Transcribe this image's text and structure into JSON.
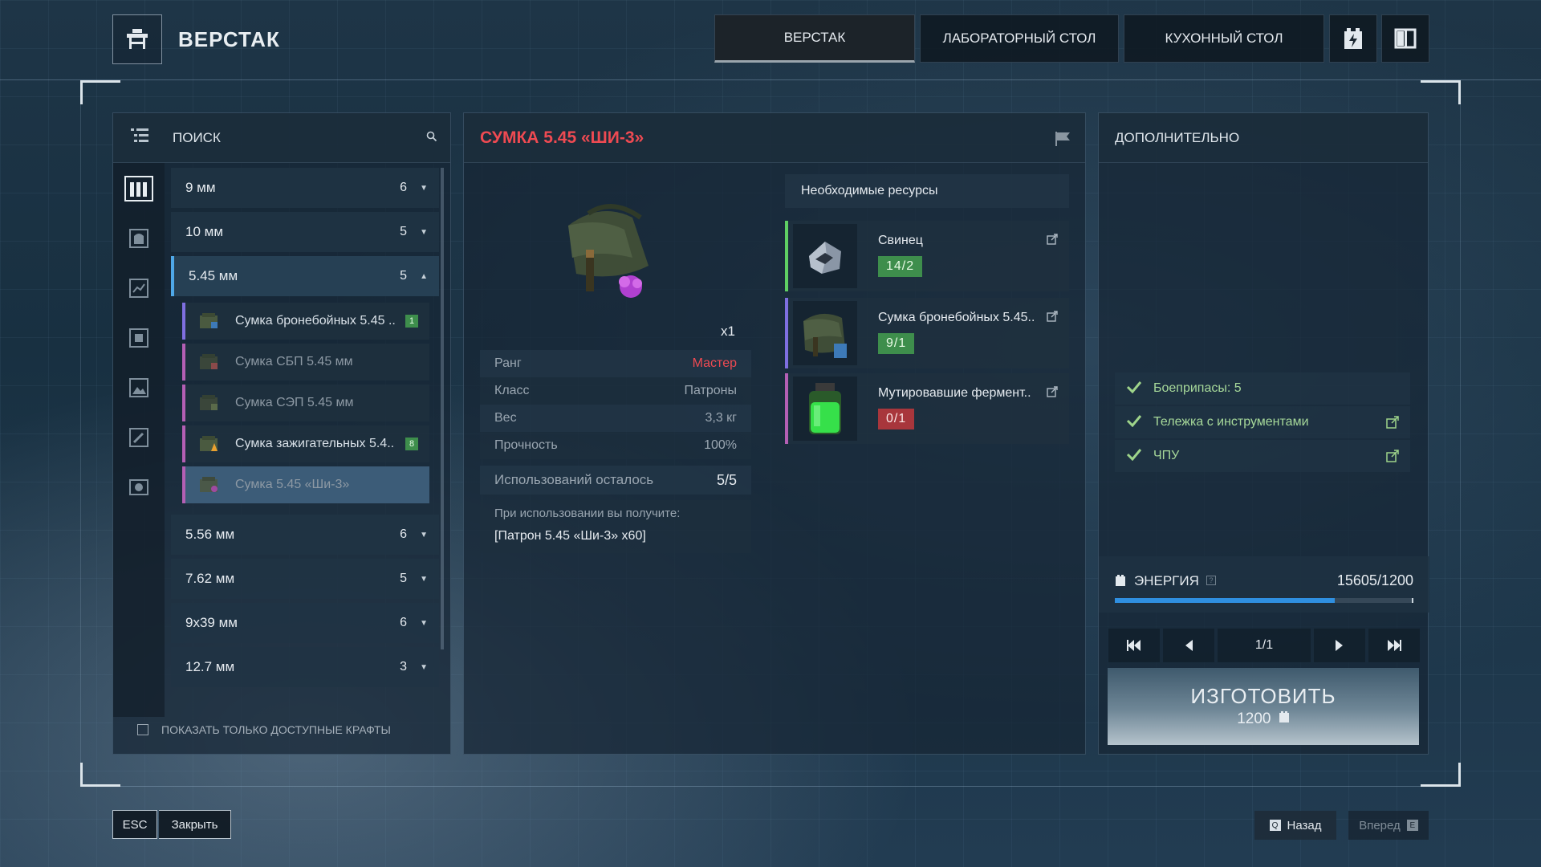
{
  "header": {
    "title": "ВЕРСТАК",
    "tabs": [
      {
        "label": "ВЕРСТАК",
        "active": true
      },
      {
        "label": "ЛАБОРАТОРНЫЙ СТОЛ",
        "active": false
      },
      {
        "label": "КУХОННЫЙ СТОЛ",
        "active": false
      }
    ],
    "icons": [
      "battery-icon",
      "book-icon"
    ]
  },
  "left_panel": {
    "search_label": "ПОИСК",
    "categories": [
      {
        "name": "9 мм",
        "count": "6"
      },
      {
        "name": "10 мм",
        "count": "5"
      },
      {
        "name": "5.45 мм",
        "count": "5",
        "expanded": true
      },
      {
        "name": "5.56 мм",
        "count": "6"
      },
      {
        "name": "7.62 мм",
        "count": "5"
      },
      {
        "name": "9x39 мм",
        "count": "6"
      },
      {
        "name": "12.7 мм",
        "count": "3"
      }
    ],
    "sub_items": [
      {
        "name": "Сумка бронебойных 5.45 ..",
        "badge": "1",
        "available": true
      },
      {
        "name": "Сумка СБП 5.45 мм",
        "badge": "",
        "available": false
      },
      {
        "name": "Сумка СЭП 5.45 мм",
        "badge": "",
        "available": false
      },
      {
        "name": "Сумка зажигательных 5.4..",
        "badge": "8",
        "available": true
      },
      {
        "name": "Сумка 5.45 «Ши-3»",
        "badge": "",
        "available": false,
        "selected": true
      }
    ],
    "show_available_label": "ПОКАЗАТЬ ТОЛЬКО ДОСТУПНЫЕ КРАФТЫ"
  },
  "item": {
    "title": "СУМКА 5.45 «ШИ-3»",
    "quantity": "x1",
    "stats": [
      {
        "key": "Ранг",
        "value": "Мастер"
      },
      {
        "key": "Класс",
        "value": "Патроны"
      },
      {
        "key": "Вес",
        "value": "3,3 кг"
      },
      {
        "key": "Прочность",
        "value": "100%"
      }
    ],
    "uses_label": "Использований осталось",
    "uses_value": "5/5",
    "on_use_label": "При использовании вы получите:",
    "on_use_value": "[Патрон 5.45 «Ши-3» х60]"
  },
  "resources": {
    "header": "Необходимые ресурсы",
    "items": [
      {
        "name": "Свинец",
        "qty": "14/2",
        "status": "ok",
        "bar_color": "#5fcf63"
      },
      {
        "name": "Сумка бронебойных 5.45..",
        "qty": "9/1",
        "status": "ok",
        "bar_color": "#7f6fe0"
      },
      {
        "name": "Мутировавшие фермент..",
        "qty": "0/1",
        "status": "missing",
        "bar_color": "#b45fb4"
      }
    ]
  },
  "right_panel": {
    "header": "ДОПОЛНИТЕЛЬНО",
    "requirements": [
      {
        "label": "Боеприпасы: 5",
        "link": false
      },
      {
        "label": "Тележка с инструментами",
        "link": true
      },
      {
        "label": "ЧПУ",
        "link": true
      }
    ],
    "energy_label": "ЭНЕРГИЯ",
    "energy_value": "15605/1200",
    "energy_fill": 0.74,
    "page": "1/1",
    "craft_label": "ИЗГОТОВИТЬ",
    "craft_cost": "1200"
  },
  "footer": {
    "esc_key": "ESC",
    "close_label": "Закрыть",
    "back_key": "Q",
    "back_label": "Назад",
    "forward_label": "Вперед",
    "forward_key": "E"
  },
  "colors": {
    "accent_red": "#ef4a52",
    "ok_green": "#3e8e4c",
    "missing_red": "#a8363c",
    "energy_blue": "#2f8fe0"
  }
}
